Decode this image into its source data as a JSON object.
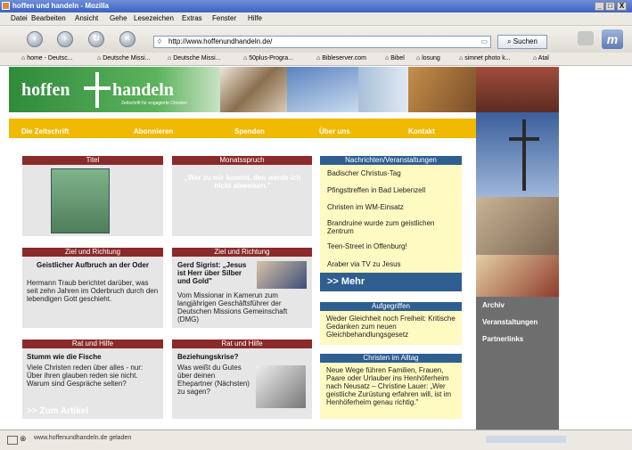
{
  "window": {
    "title": "hoffen und handeln - Mozilla",
    "minimize": "_",
    "maximize": "□",
    "close": "X"
  },
  "menu": [
    "Datei",
    "Bearbeiten",
    "Ansicht",
    "Gehe",
    "Lesezeichen",
    "Extras",
    "Fenster",
    "Hilfe"
  ],
  "navbar": {
    "url": "http://www.hoffenundhandeln.de/",
    "search_label": "Suchen"
  },
  "bookmarks": [
    "home - Deutsc...",
    "Deutsche Missi...",
    "Deutsche Missi...",
    "50plus-Progra...",
    "Bibleserver.com",
    "Bibel",
    "losung",
    "simnet photo k...",
    "Atal"
  ],
  "site": {
    "logo_left": "hoffen",
    "logo_right": "handeln",
    "tagline": "Zeitschrift für engagierte Christen",
    "nav": [
      "Die Zeitschrift",
      "Abonnieren",
      "Spenden",
      "Über uns",
      "Kontakt"
    ],
    "titel_header": "Titel",
    "monatsspruch_header": "Monatsspruch",
    "monatsspruch_text": "„Wer zu mir kommt, den werde ich nicht abweisen.\"",
    "news": {
      "header": "Nachrichten/Veranstaltungen",
      "items": [
        "Badischer Christus-Tag",
        "Pfingsttreffen in Bad Liebenzell",
        "Christen im WM-Einsatz",
        "Brandruine wurde zum geistlichen Zentrum",
        "Teen-Street in Offenburg!",
        "Araber via TV zu Jesus"
      ],
      "more": ">> Mehr"
    },
    "ziel1": {
      "header": "Ziel und Richtung",
      "title": "Geistlicher Aufbruch an der Oder",
      "body": "Hermann Traub berichtet darüber, was seit zehn Jahren im Oderbruch durch den lebendigen Gott geschieht."
    },
    "ziel2": {
      "header": "Ziel und Richtung",
      "title": "Gerd Sigrist: „Jesus ist Herr über Silber und Gold\"",
      "body": "Vom Missionar in Kamerun zum langjährigen Geschäftsführer der Deutschen Missions Gemeinschaft (DMG)"
    },
    "aufgegriffen": {
      "header": "Aufgegriffen",
      "body": "Weder Gleichheit noch Freiheit: Kritische Gedanken zum neuen Gleichbehandlungsgesetz"
    },
    "rat1": {
      "header": "Rat und Hilfe",
      "title": "Stumm wie die Fische",
      "body": "Viele Christen reden über alles - nur: Über ihren glauben reden sie nicht. Warum sind Gespräche selten?",
      "link": ">> Zum Artikel"
    },
    "rat2": {
      "header": "Rat und Hilfe",
      "title": "Beziehungskrise?",
      "body": "Was weißt du Gutes über deinen Ehepartner (Nächsten) zu sagen?"
    },
    "alltag": {
      "header": "Christen im Alltag",
      "body": "Neue Wege führen Familien, Frauen, Paare oder Urlauber ins Henhöferheim nach Neusatz – Christine Lauer: „Wer geistliche Zurüstung erfahren will, ist im Henhöferheim genau richtig.\""
    },
    "side_links": [
      "Archiv",
      "Veranstaltungen",
      "Partnerlinks"
    ]
  },
  "status": {
    "text": "www.hoffenundhandeln.de geladen"
  }
}
